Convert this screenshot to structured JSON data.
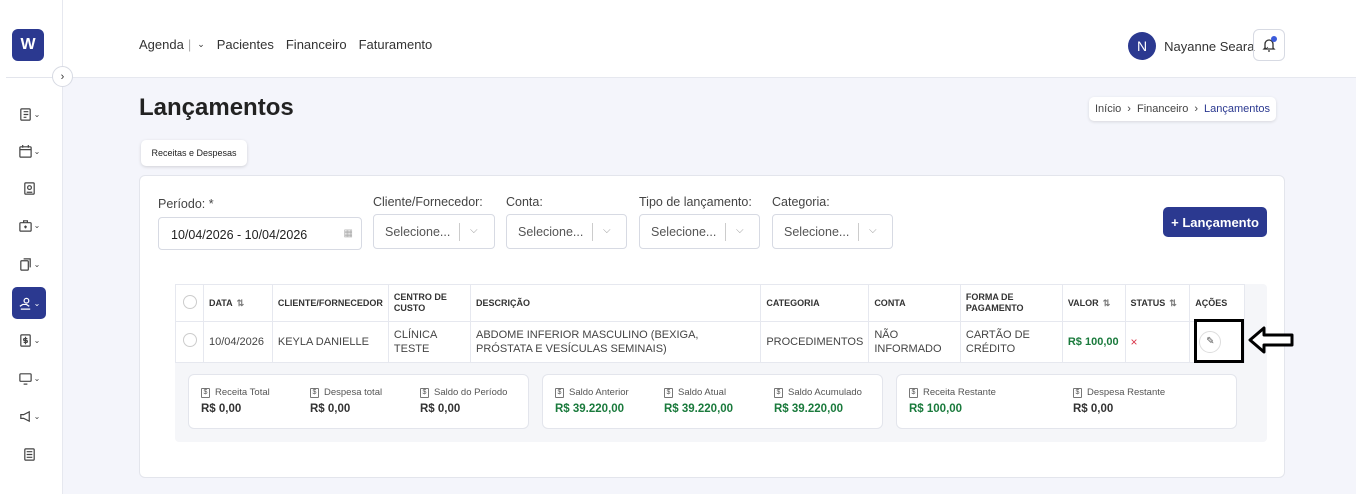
{
  "sidebar": {
    "logo": "W",
    "collapse": "›"
  },
  "nav": {
    "items": [
      "Agenda",
      "Pacientes",
      "Financeiro",
      "Faturamento"
    ]
  },
  "user": {
    "initial": "N",
    "name": "Nayanne Seara"
  },
  "page": {
    "title": "Lançamentos",
    "tab": "Receitas e Despesas"
  },
  "breadcrumb": {
    "items": [
      "Início",
      "Financeiro",
      "Lançamentos"
    ]
  },
  "filters": {
    "periodo_label": "Período: *",
    "periodo_value": "10/04/2026 - 10/04/2026",
    "cliente_label": "Cliente/Fornecedor:",
    "conta_label": "Conta:",
    "tipo_label": "Tipo de lançamento:",
    "categoria_label": "Categoria:",
    "placeholder": "Selecione..."
  },
  "add_button": "+ Lançamento",
  "table": {
    "headers": [
      "DATA",
      "CLIENTE/FORNECEDOR",
      "CENTRO DE CUSTO",
      "DESCRIÇÃO",
      "CATEGORIA",
      "CONTA",
      "FORMA DE PAGAMENTO",
      "VALOR",
      "STATUS",
      "AÇÕES"
    ],
    "rows": [
      {
        "data": "10/04/2026",
        "cliente": "KEYLA DANIELLE",
        "centro": "CLÍNICA TESTE",
        "descricao": "ABDOME INFERIOR MASCULINO (BEXIGA, PRÓSTATA E VESÍCULAS SEMINAIS)",
        "categoria": "PROCEDIMENTOS",
        "conta": "NÃO INFORMADO",
        "forma": "CARTÃO DE CRÉDITO",
        "valor": "R$ 100,00",
        "status": "×"
      }
    ]
  },
  "summary": {
    "g1": [
      {
        "label": "Receita Total",
        "value": "R$ 0,00"
      },
      {
        "label": "Despesa total",
        "value": "R$ 0,00"
      },
      {
        "label": "Saldo do Período",
        "value": "R$ 0,00"
      }
    ],
    "g2": [
      {
        "label": "Saldo Anterior",
        "value": "R$ 39.220,00"
      },
      {
        "label": "Saldo Atual",
        "value": "R$ 39.220,00"
      },
      {
        "label": "Saldo Acumulado",
        "value": "R$ 39.220,00"
      }
    ],
    "g3": [
      {
        "label": "Receita Restante",
        "value": "R$ 100,00"
      },
      {
        "label": "Despesa Restante",
        "value": "R$ 0,00"
      }
    ]
  },
  "colors": {
    "primary": "#2b3990",
    "positive": "#1a7a3c",
    "negative": "#d9364a"
  }
}
